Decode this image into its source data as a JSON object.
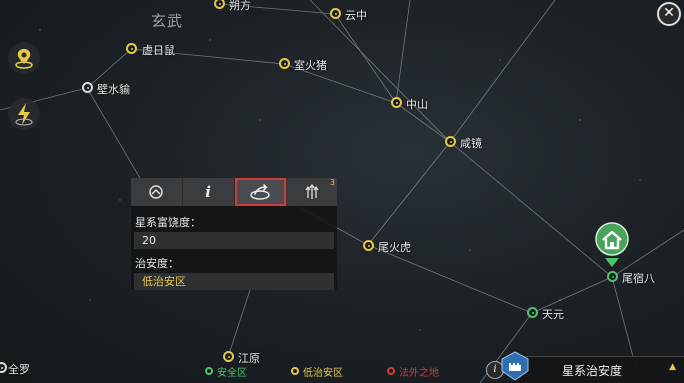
{
  "regions": {
    "xuanwu": "玄武"
  },
  "stars": {
    "shuofang": "朔方",
    "yunzhong": "云中",
    "xurishu": "虚日鼠",
    "shihuozhu": "室火猪",
    "bishuiyu": "壁水貐",
    "zhongshan": "中山",
    "xianjing": "咸镜",
    "weihuohu": "尾火虎",
    "weisuba": "尾宿八",
    "tianyuan": "天元",
    "jiangyuan": "江原",
    "quanluo": "全罗"
  },
  "panel": {
    "wealth_label": "星系富饶度：",
    "wealth_value": "20",
    "order_label": "治安度：",
    "order_value": "低治安区",
    "tool_badge": "3"
  },
  "legend": {
    "safe": "安全区",
    "low_order": "低治安区",
    "lawless": "法外之地"
  },
  "bottom_tab": {
    "label": "星系治安度"
  },
  "colors": {
    "accent_yellow": "#e6c84a",
    "safe_green": "#4cc46a",
    "lawless_red": "#d23a3a",
    "home_green": "#4aa35a"
  },
  "icons": {
    "close": "close-icon",
    "location": "location-pin-icon",
    "lightning": "lightning-icon",
    "info": "info-icon",
    "home": "home-icon",
    "castle": "castle-icon"
  }
}
